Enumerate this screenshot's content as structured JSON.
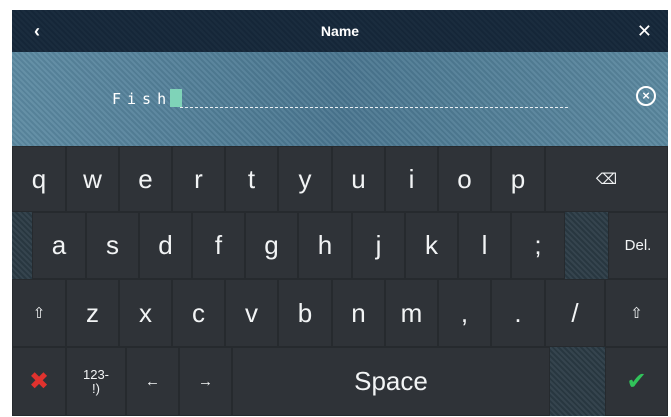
{
  "header": {
    "title": "Name",
    "back_icon": "‹",
    "close_icon": "✕"
  },
  "input": {
    "value": "Fish",
    "clear_icon": "×"
  },
  "keyboard": {
    "row1": [
      "q",
      "w",
      "e",
      "r",
      "t",
      "y",
      "u",
      "i",
      "o",
      "p"
    ],
    "backspace_icon": "⌫",
    "row2": [
      "a",
      "s",
      "d",
      "f",
      "g",
      "h",
      "j",
      "k",
      "l",
      ";"
    ],
    "delete_label": "Del.",
    "shift_icon": "⇧",
    "row3": [
      "z",
      "x",
      "c",
      "v",
      "b",
      "n",
      "m",
      ",",
      ".",
      "/"
    ],
    "cancel_icon": "✖",
    "symbols_label": "123-\n!)",
    "left_arrow": "←",
    "right_arrow": "→",
    "space_label": "Space",
    "enter_icon": "✔"
  },
  "colors": {
    "header_bg": "#16283a",
    "input_bg": "#4f7d95",
    "key_bg": "#2f3338",
    "cancel": "#e0322e",
    "confirm": "#31c35a"
  }
}
